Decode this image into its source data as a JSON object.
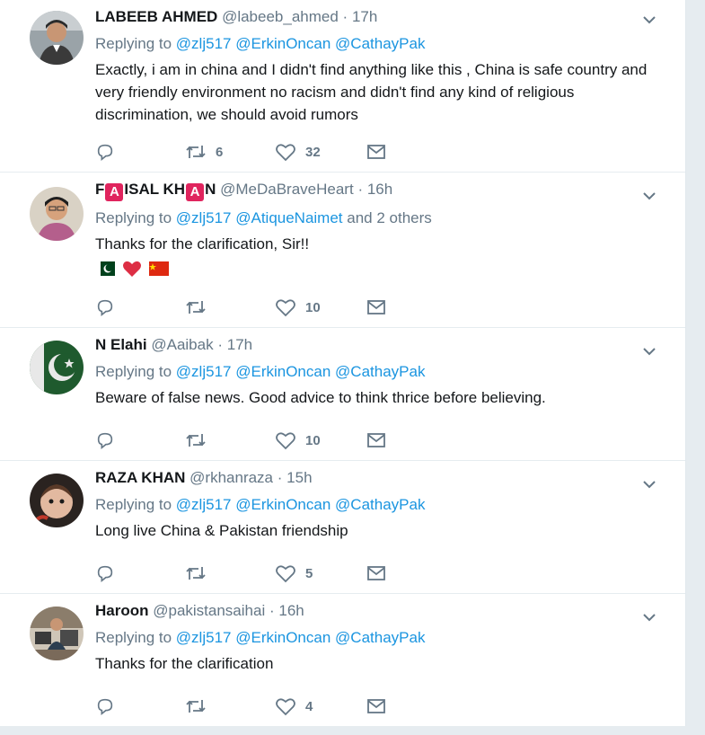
{
  "tweets": [
    {
      "name": "LABEEB AHMED",
      "handle": "@labeeb_ahmed",
      "time": "17h",
      "replying_label": "Replying to",
      "mentions": [
        "@zlj517",
        "@ErkinOncan",
        "@CathayPak"
      ],
      "text": "Exactly, i am in china and I didn't find anything like this , China is safe country and very friendly environment no racism and didn't find any kind of religious discrimination, we should avoid rumors",
      "retweets": "6",
      "likes": "32"
    },
    {
      "name_parts": [
        "F",
        "A",
        "ISAL KH",
        "A",
        "N"
      ],
      "handle": "@MeDaBraveHeart",
      "time": "16h",
      "replying_label": "Replying to",
      "mentions": [
        "@zlj517",
        "@AtiqueNaimet"
      ],
      "others": "and 2 others",
      "text": "Thanks for the clarification, Sir!!",
      "emojis": [
        "pakistan-flag",
        "red-heart",
        "china-flag"
      ],
      "retweets": "",
      "likes": "10"
    },
    {
      "name": "N Elahi",
      "handle": "@Aaibak",
      "time": "17h",
      "replying_label": "Replying to",
      "mentions": [
        "@zlj517",
        "@ErkinOncan",
        "@CathayPak"
      ],
      "text": "Beware of false news. Good advice to think thrice before believing.",
      "retweets": "",
      "likes": "10"
    },
    {
      "name": "RAZA KHAN",
      "handle": "@rkhanraza",
      "time": "15h",
      "replying_label": "Replying to",
      "mentions": [
        "@zlj517",
        "@ErkinOncan",
        "@CathayPak"
      ],
      "text": "Long live China & Pakistan friendship",
      "retweets": "",
      "likes": "5"
    },
    {
      "name": "Haroon",
      "handle": "@pakistansaihai",
      "time": "16h",
      "replying_label": "Replying to",
      "mentions": [
        "@zlj517",
        "@ErkinOncan",
        "@CathayPak"
      ],
      "text": "Thanks for the clarification",
      "retweets": "",
      "likes": "4"
    }
  ],
  "colors": {
    "link": "#1b95e0",
    "muted": "#657786",
    "text": "#14171a",
    "divider": "#e6ecf0"
  },
  "icons": [
    "reply-icon",
    "retweet-icon",
    "like-icon",
    "direct-message-icon",
    "chevron-down-icon"
  ]
}
